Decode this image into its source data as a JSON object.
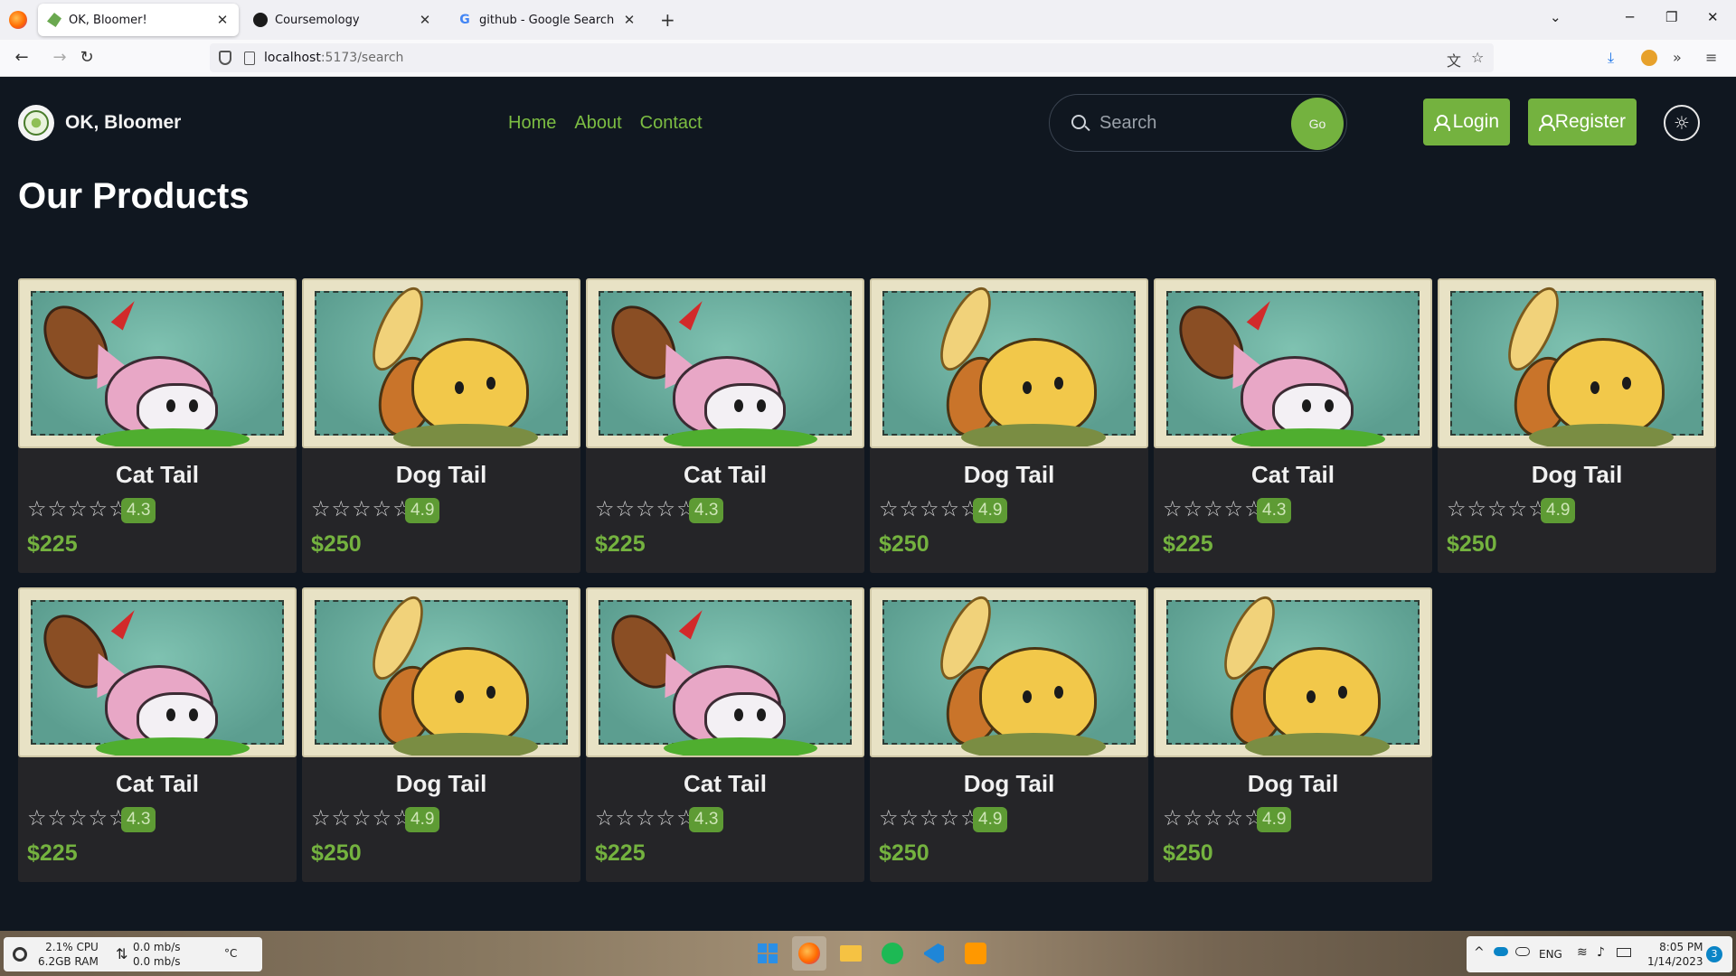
{
  "browser": {
    "tabs": [
      {
        "title": "OK, Bloomer!",
        "active": true,
        "favicon": "leaf-icon"
      },
      {
        "title": "Coursemology",
        "active": false,
        "favicon": "coursemology-icon"
      },
      {
        "title": "github - Google Search",
        "active": false,
        "favicon": "google-icon"
      }
    ],
    "url_host": "localhost",
    "url_path": ":5173/search"
  },
  "app": {
    "brand": "OK, Bloomer",
    "nav": {
      "home": "Home",
      "about": "About",
      "contact": "Contact"
    },
    "search": {
      "placeholder": "Search",
      "go": "Go"
    },
    "login": "Login",
    "register": "Register",
    "heading": "Our Products",
    "accent": "#74b23f"
  },
  "products": [
    {
      "name": "Cat Tail",
      "rating": "4.3",
      "price": "$225",
      "kind": "cat"
    },
    {
      "name": "Dog Tail",
      "rating": "4.9",
      "price": "$250",
      "kind": "dog"
    },
    {
      "name": "Cat Tail",
      "rating": "4.3",
      "price": "$225",
      "kind": "cat"
    },
    {
      "name": "Dog Tail",
      "rating": "4.9",
      "price": "$250",
      "kind": "dog"
    },
    {
      "name": "Cat Tail",
      "rating": "4.3",
      "price": "$225",
      "kind": "cat"
    },
    {
      "name": "Dog Tail",
      "rating": "4.9",
      "price": "$250",
      "kind": "dog"
    },
    {
      "name": "Cat Tail",
      "rating": "4.3",
      "price": "$225",
      "kind": "cat"
    },
    {
      "name": "Dog Tail",
      "rating": "4.9",
      "price": "$250",
      "kind": "dog"
    },
    {
      "name": "Cat Tail",
      "rating": "4.3",
      "price": "$225",
      "kind": "cat"
    },
    {
      "name": "Dog Tail",
      "rating": "4.9",
      "price": "$250",
      "kind": "dog"
    },
    {
      "name": "Dog Tail",
      "rating": "4.9",
      "price": "$250",
      "kind": "dog"
    }
  ],
  "taskbar": {
    "cpu": "2.1% CPU",
    "ram": "6.2GB RAM",
    "net_up": "0.0 mb/s",
    "net_down": "0.0 mb/s",
    "temp": "°C",
    "lang": "ENG",
    "time": "8:05 PM",
    "date": "1/14/2023",
    "notifications": "3"
  }
}
